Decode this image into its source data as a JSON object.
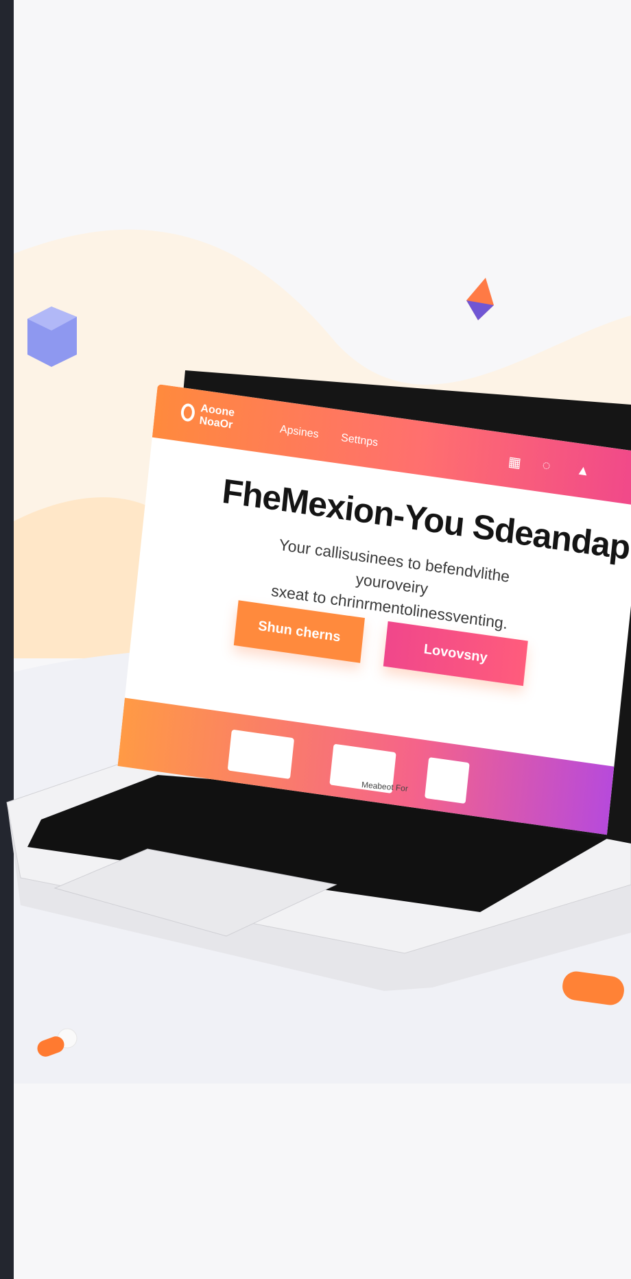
{
  "screen": {
    "logo_line1": "Aoone",
    "logo_line2": "NoaOr",
    "nav_links": [
      "Apsines",
      "Settnps"
    ],
    "hero_title": "FheMexion-You Sdeandap",
    "hero_subtitle_line1": "Your callisusinees to befendvlithe youroveiry",
    "hero_subtitle_line2": "sxeat to chrinrmentolinessventing.",
    "primary_button": "Shun cherns",
    "secondary_button": "Lovovsny"
  },
  "laptop": {
    "brand_label": "Meabeot For"
  },
  "icons": {
    "nav_icon_1": "shopping-bag-icon",
    "nav_icon_2": "chat-icon",
    "nav_icon_3": "bell-icon"
  },
  "colors": {
    "nav_start": "#ff8a3d",
    "nav_end": "#f0478b",
    "primary_button": "#ff8a3d",
    "secondary_button": "#f0478b",
    "sidebar": "#23262f"
  }
}
